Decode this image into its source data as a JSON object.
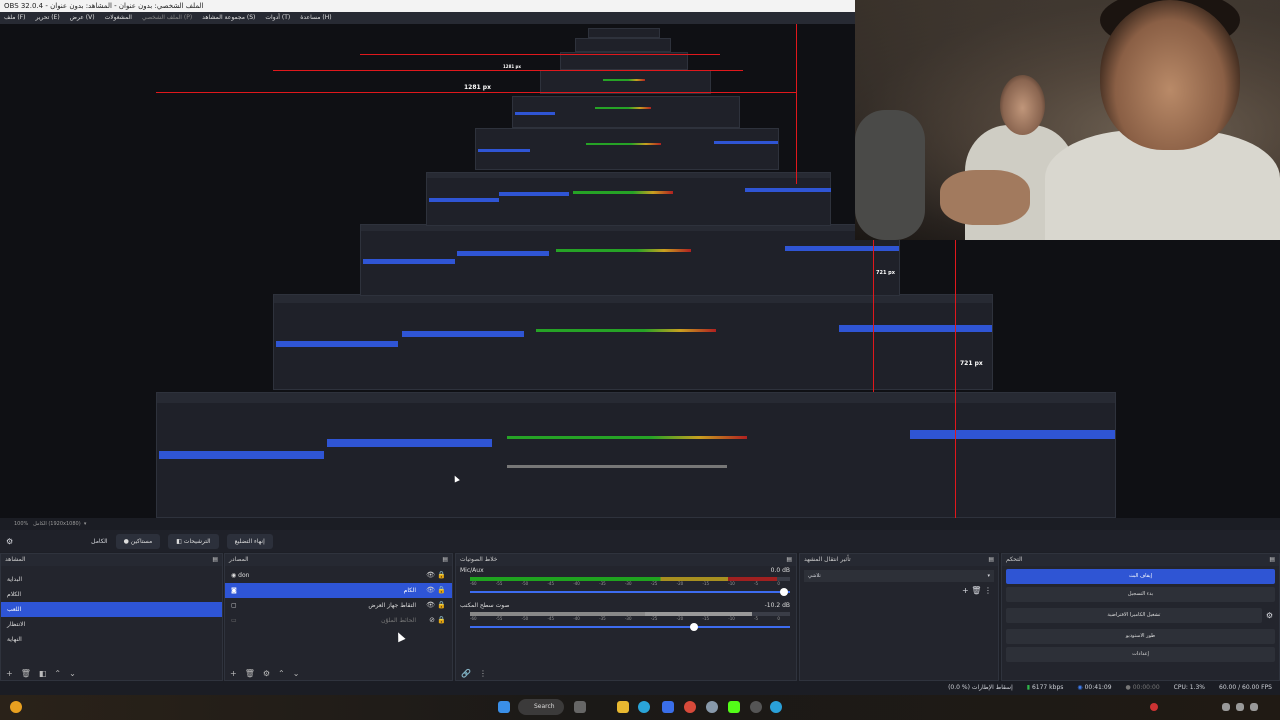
{
  "window": {
    "title": "OBS 32.0.4 - الملف الشخصي: بدون عنوان - المشاهد: بدون عنوان"
  },
  "menu": [
    "ملف (F)",
    "تحرير (E)",
    "عرض (V)",
    "المشغولات",
    "الملف الشخصي (P)",
    "مجموعة المشاهد (S)",
    "أدوات (T)",
    "مساعدة (H)"
  ],
  "preview": {
    "label_1281": "1281 px",
    "label_721": "721 px",
    "zoom": "100%",
    "canvas_info": "الكامل (1920x1080)"
  },
  "toolbar": {
    "label_full": "الكامل",
    "transitions": "مستاكين",
    "studio": "الترشيحات",
    "exit_full": "إنهاء التضليع"
  },
  "scenes": {
    "title": "المشاهد",
    "items": [
      "البداية",
      "الكلام",
      "اللعب",
      "الانتظار",
      "النهاية"
    ],
    "selected": 2
  },
  "sources": {
    "title": "المصادر",
    "items": [
      {
        "name": "don"
      },
      {
        "name": "الكام"
      },
      {
        "name": "التقاط جهاز العرض"
      },
      {
        "name": "الحائط الملوّن"
      }
    ],
    "selected": 1
  },
  "mixer": {
    "title": "خلاط الصوتيات",
    "tracks": [
      {
        "name": "Mic/Aux",
        "db": "0.0 dB",
        "level": 0.96,
        "volume": 0.98
      },
      {
        "name": "صوت سطح المكتب",
        "db": "-10.2 dB",
        "level": 0.88,
        "volume": 0.7
      }
    ],
    "scale": [
      "-60",
      "-55",
      "-50",
      "-45",
      "-40",
      "-35",
      "-30",
      "-25",
      "-20",
      "-15",
      "-10",
      "-5",
      "0"
    ]
  },
  "transitions": {
    "title": "تأثير انتقال المشهد",
    "selected": "تلاشي"
  },
  "controls": {
    "title": "التحكم",
    "buttons": [
      "إيقاف البث",
      "بدء التسجيل",
      "تشغيل الكاميرا الافتراضية",
      "طور الاستوديو",
      "إعدادات"
    ],
    "active": 0
  },
  "status": {
    "dropped": "(0.0 %) إسقاط الإطارات",
    "bitrate": "6177 kbps",
    "live_time": "00:41:09",
    "rec_time": "00:00:00",
    "cpu": "CPU: 1.3%",
    "fps": "60.00 / 60.00 FPS"
  },
  "taskbar": {
    "search": "Search"
  },
  "colors": {
    "accent": "#2f55d4",
    "guide": "#e0181c",
    "bg": "#1d1f26"
  }
}
